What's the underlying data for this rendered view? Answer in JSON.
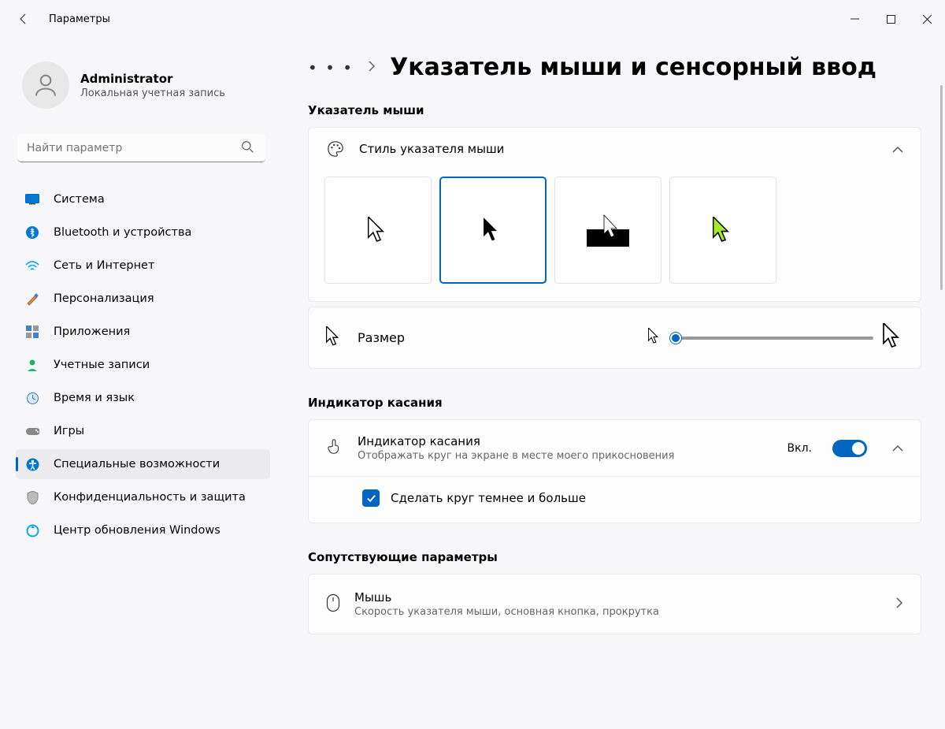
{
  "titlebar": {
    "title": "Параметры"
  },
  "user": {
    "name": "Administrator",
    "account": "Локальная учетная запись"
  },
  "search": {
    "placeholder": "Найти параметр"
  },
  "nav": [
    {
      "id": "system",
      "label": "Система"
    },
    {
      "id": "bluetooth",
      "label": "Bluetooth и устройства"
    },
    {
      "id": "network",
      "label": "Сеть и Интернет"
    },
    {
      "id": "personalization",
      "label": "Персонализация"
    },
    {
      "id": "apps",
      "label": "Приложения"
    },
    {
      "id": "accounts",
      "label": "Учетные записи"
    },
    {
      "id": "time",
      "label": "Время и язык"
    },
    {
      "id": "gaming",
      "label": "Игры"
    },
    {
      "id": "accessibility",
      "label": "Специальные возможности",
      "active": true
    },
    {
      "id": "privacy",
      "label": "Конфиденциальность и защита"
    },
    {
      "id": "update",
      "label": "Центр обновления Windows"
    }
  ],
  "page": {
    "title": "Указатель мыши и сенсорный ввод"
  },
  "pointer_section": {
    "title": "Указатель мыши",
    "style_label": "Стиль указателя мыши",
    "size_label": "Размер",
    "selected_style": 1
  },
  "touch_section": {
    "title": "Индикатор касания",
    "row_title": "Индикатор касания",
    "row_sub": "Отображать круг на экране в месте моего прикосновения",
    "toggle_state": "Вкл.",
    "sub_label": "Сделать круг темнее и больше"
  },
  "related_section": {
    "title": "Сопутствующие параметры",
    "mouse_title": "Мышь",
    "mouse_sub": "Скорость указателя мыши, основная кнопка, прокрутка"
  }
}
